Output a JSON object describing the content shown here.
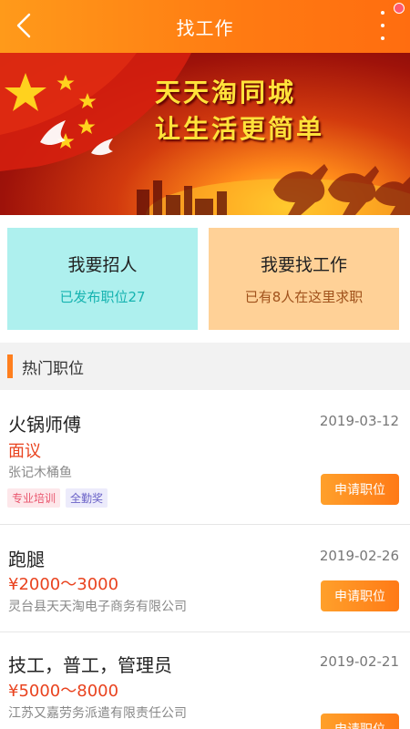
{
  "header": {
    "title": "找工作",
    "back_icon": "chevron-left-icon",
    "more_icon": "more-vertical-icon",
    "accent_color": "#ff7a12"
  },
  "banner": {
    "slogan_line1": "天天淘同城",
    "slogan_line2": "让生活更简单"
  },
  "cards": {
    "recruit": {
      "title": "我要招人",
      "subtitle": "已发布职位27",
      "color": "#aef0ee"
    },
    "find_job": {
      "title": "我要找工作",
      "subtitle": "已有8人在这里求职",
      "color": "#ffd197"
    }
  },
  "section": {
    "label": "热门职位"
  },
  "jobs": [
    {
      "title": "火锅师傅",
      "date": "2019-03-12",
      "salary": "面议",
      "company": "张记木桶鱼",
      "tags": [
        "专业培训",
        "全勤奖"
      ],
      "apply_label": "申请职位"
    },
    {
      "title": "跑腿",
      "date": "2019-02-26",
      "salary": "¥2000～3000",
      "company": "灵台县天天淘电子商务有限公司",
      "apply_label": "申请职位"
    },
    {
      "title": "技工，普工，管理员",
      "date": "2019-02-21",
      "salary": "¥5000～8000",
      "company": "江苏又嘉劳务派遣有限责任公司",
      "apply_label": "申请职位"
    }
  ]
}
